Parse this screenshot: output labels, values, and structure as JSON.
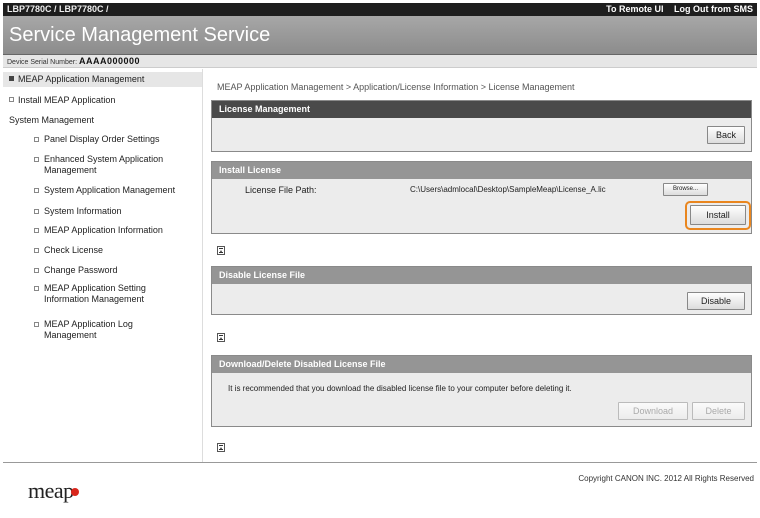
{
  "header": {
    "model": "LBP7780C / LBP7780C /",
    "remote_ui_link": "To Remote UI",
    "logout_link": "Log Out from SMS"
  },
  "title": "Service Management Service",
  "serial": {
    "label": "Device Serial Number:",
    "value": "AAAA000000"
  },
  "sidebar": {
    "items": [
      {
        "label": "MEAP Application Management"
      },
      {
        "label": "Install MEAP Application"
      },
      {
        "label": "System Management"
      },
      {
        "label": "Panel Display Order Settings"
      },
      {
        "label": "Enhanced System Application",
        "label2": "Management"
      },
      {
        "label": "System Application Management"
      },
      {
        "label": "System Information"
      },
      {
        "label": "MEAP Application Information"
      },
      {
        "label": "Check License"
      },
      {
        "label": "Change Password"
      },
      {
        "label": "MEAP Application Setting",
        "label2": "Information Management"
      },
      {
        "label": "MEAP Application Log",
        "label2": "Management"
      }
    ]
  },
  "breadcrumb": "MEAP Application Management > Application/License Information > License Management",
  "license_mgmt": {
    "title": "License Management",
    "back_button": "Back"
  },
  "install_license": {
    "title": "Install License",
    "path_label": "License File Path:",
    "path_value": "C:\\Users\\admlocal\\Desktop\\SampleMeap\\License_A.lic",
    "browse_button": "Browse...",
    "install_button": "Install"
  },
  "disable_license": {
    "title": "Disable License File",
    "disable_button": "Disable"
  },
  "download_delete": {
    "title": "Download/Delete Disabled License File",
    "message": "It is recommended that you download the disabled license file to your computer before deleting it.",
    "download_button": "Download",
    "delete_button": "Delete"
  },
  "footer": {
    "copyright": "Copyright CANON INC. 2012 All Rights Reserved",
    "logo": "meap"
  },
  "colors": {
    "highlight": "#e9861f",
    "dark_header": "#4a4a4a",
    "light_header": "#959595",
    "logo_dot": "#d9261c"
  }
}
